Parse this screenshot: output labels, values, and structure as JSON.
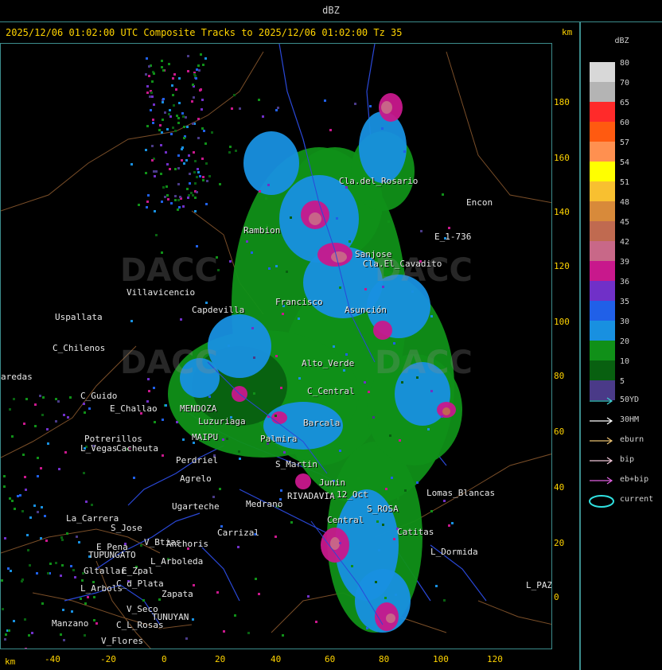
{
  "window": {
    "title": "dBZ"
  },
  "header": {
    "text": "2025/12/06 01:02:00 UTC Composite Tracks to 2025/12/06 01:02:00 Tz 35",
    "unit": "km"
  },
  "axes": {
    "x_unit": "km",
    "x_ticks": [
      "-40",
      "-20",
      "0",
      "20",
      "40",
      "60",
      "80",
      "100",
      "120"
    ],
    "y_ticks": [
      "180",
      "160",
      "140",
      "120",
      "100",
      "80",
      "60",
      "40",
      "20",
      "0"
    ]
  },
  "legend": {
    "title": "dBZ",
    "scale": [
      {
        "label": "80",
        "color": "#d8d8d8"
      },
      {
        "label": "70",
        "color": "#b4b4b4"
      },
      {
        "label": "65",
        "color": "#ff2a2a"
      },
      {
        "label": "60",
        "color": "#ff5a10"
      },
      {
        "label": "57",
        "color": "#ff9050"
      },
      {
        "label": "54",
        "color": "#ffff00"
      },
      {
        "label": "51",
        "color": "#f8c030"
      },
      {
        "label": "48",
        "color": "#d88a3a"
      },
      {
        "label": "45",
        "color": "#c06a50"
      },
      {
        "label": "42",
        "color": "#c86888"
      },
      {
        "label": "39",
        "color": "#c8188c"
      },
      {
        "label": "36",
        "color": "#7030c8"
      },
      {
        "label": "35",
        "color": "#2060e8"
      },
      {
        "label": "30",
        "color": "#1890e0"
      },
      {
        "label": "20",
        "color": "#109018"
      },
      {
        "label": "10",
        "color": "#086010"
      },
      {
        "label": "5",
        "color": "#4a3a88"
      }
    ],
    "tracks": [
      {
        "label": "50YD",
        "color": "#40d0d0",
        "kind": "arrow"
      },
      {
        "label": "30HM",
        "color": "#ffffff",
        "kind": "arrow"
      },
      {
        "label": "eburn",
        "color": "#e8c070",
        "kind": "arrow"
      },
      {
        "label": "bip",
        "color": "#f0c8d8",
        "kind": "arrow"
      },
      {
        "label": "eb+bip",
        "color": "#e060e0",
        "kind": "arrow"
      },
      {
        "label": "current",
        "color": "#30e0e0",
        "kind": "ellipse"
      }
    ]
  },
  "places": [
    {
      "name": "Cla.del_Rosario"
    },
    {
      "name": "Encon"
    },
    {
      "name": "E_1-736"
    },
    {
      "name": "Rambion"
    },
    {
      "name": "Sanjose"
    },
    {
      "name": "Cla.El_Cavadito"
    },
    {
      "name": "Villavicencio"
    },
    {
      "name": "Uspallata"
    },
    {
      "name": "Capdevilla"
    },
    {
      "name": "Francisco"
    },
    {
      "name": "Asunción"
    },
    {
      "name": "C_Chilenos"
    },
    {
      "name": "aredas"
    },
    {
      "name": "C_Guido"
    },
    {
      "name": "E_Challao"
    },
    {
      "name": "MENDOZA"
    },
    {
      "name": "Potrerillos"
    },
    {
      "name": "Cacheuta"
    },
    {
      "name": "L_Vegas"
    },
    {
      "name": "Luzuriaga"
    },
    {
      "name": "MAIPU"
    },
    {
      "name": "Perdriel"
    },
    {
      "name": "Agrelo"
    },
    {
      "name": "Ugarteche"
    },
    {
      "name": "La_Carrera"
    },
    {
      "name": "S_Jose"
    },
    {
      "name": "E_Pena"
    },
    {
      "name": "TUPUNGATO"
    },
    {
      "name": "V_Btias"
    },
    {
      "name": "Anchoris"
    },
    {
      "name": "Carrizal"
    },
    {
      "name": "L_Arboleda"
    },
    {
      "name": "Gltallar"
    },
    {
      "name": "E_Zpal"
    },
    {
      "name": "L_Arbols"
    },
    {
      "name": "C_d_Plata"
    },
    {
      "name": "Zapata"
    },
    {
      "name": "V_Seco"
    },
    {
      "name": "Manzano"
    },
    {
      "name": "C_L_Rosas"
    },
    {
      "name": "TUNUYAN"
    },
    {
      "name": "V_Flores"
    },
    {
      "name": "Lomas_Blancas"
    },
    {
      "name": "12_Oct"
    },
    {
      "name": "S_ROSA"
    },
    {
      "name": "Catitas"
    },
    {
      "name": "L_Dormida"
    },
    {
      "name": "L_PAZ"
    },
    {
      "name": "Central"
    },
    {
      "name": "RIVADAVIA"
    },
    {
      "name": "Medrano"
    },
    {
      "name": "Junin"
    },
    {
      "name": "S_Martin"
    },
    {
      "name": "Palmira"
    },
    {
      "name": "Barcala"
    },
    {
      "name": "C_Central"
    },
    {
      "name": "Alto_Verde"
    }
  ],
  "watermark": {
    "text": "DACC"
  }
}
